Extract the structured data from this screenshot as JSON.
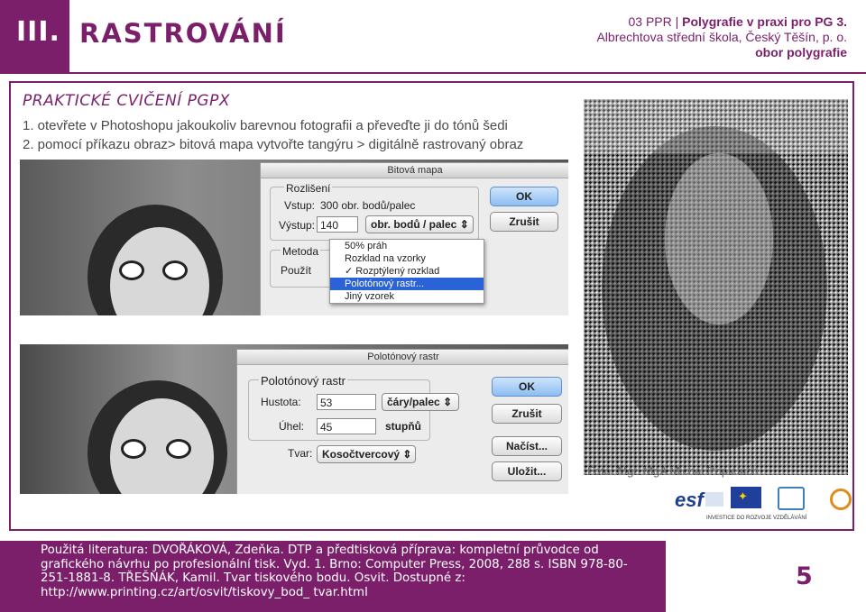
{
  "header": {
    "chapter_number": "III.",
    "title": "RASTROVÁNÍ",
    "course_prefix": "03 PPR | ",
    "course_name": "Polygrafie v praxi pro PG 3.",
    "school": "Albrechtova střední škola, Český Těšín, p. o.",
    "department": "obor polygrafie"
  },
  "section": {
    "title": "PRAKTICKÉ CVIČENÍ PGPX",
    "steps": [
      "1.  otevřete v Photoshopu jakoukoliv barevnou fotografii a převeďte ji do tónů šedi",
      "2.  pomocí příkazu obraz> bitová mapa vytvořte tangýru > digitálně rastrovaný obraz"
    ]
  },
  "dialog_bitmap": {
    "title": "Bitová mapa",
    "group_resolution": "Rozlišení",
    "input_label": "Vstup:",
    "input_value": "300 obr. bodů/palec",
    "output_label": "Výstup:",
    "output_value": "140",
    "unit_select": "obr. bodů / palec",
    "method_label": "Metoda",
    "use_label": "Použít",
    "ok": "OK",
    "cancel": "Zrušit",
    "menu_items": [
      "50% práh",
      "Rozklad na vzorky",
      "✓ Rozptýlený rozklad",
      "Polotónový rastr...",
      "Jiný vzorek"
    ],
    "menu_selected": "Polotónový rastr..."
  },
  "dialog_halftone": {
    "title": "Polotónový rastr",
    "group": "Polotónový rastr",
    "frequency_label": "Hustota:",
    "frequency_value": "53",
    "frequency_unit": "čáry/palec",
    "angle_label": "Úhel:",
    "angle_value": "45",
    "angle_unit": "stupňů",
    "shape_label": "Tvar:",
    "shape_value": "Kosočtvercový",
    "ok": "OK",
    "cancel": "Zrušit",
    "load": "Načíst...",
    "save": "Uložit..."
  },
  "photo_credit": "Foto: Mgr. MgA Michal Popieluch",
  "logos": {
    "esf_text": "esf",
    "caption": "INVESTICE DO ROZVOJE VZDĚLÁVÁNÍ"
  },
  "footer": {
    "literature": "Použitá literatura: DVOŘÁKOVÁ, Zdeňka. DTP a předtisková příprava: kompletní průvodce od grafického návrhu po profesionální tisk. Vyd. 1. Brno: Computer Press, 2008, 288 s. ISBN 978-80-251-1881-8. TŘEŠŇÁK, Kamil. Tvar tiskového bodu. Osvit. Dostupné z: http://www.printing.cz/art/osvit/tiskovy_bod_ tvar.html",
    "page_number": "5"
  },
  "colors": {
    "brand": "#7b1f6a",
    "text": "#4a4a4a"
  }
}
